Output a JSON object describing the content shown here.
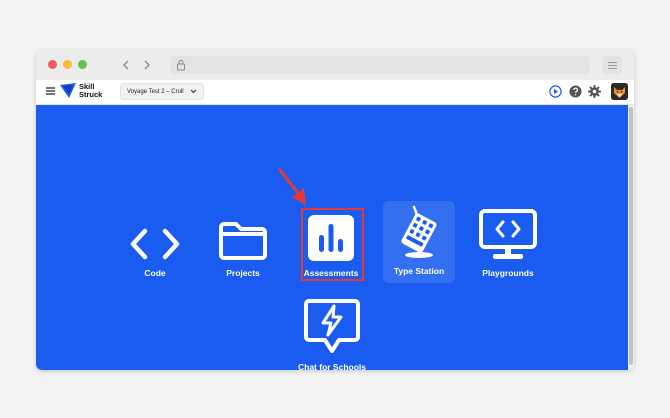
{
  "colors": {
    "content_bg": "#1a5cf0",
    "highlight_red": "#e53935",
    "brand_blue": "#1a5cf0"
  },
  "browser": {
    "icons": [
      "chevron-left-icon",
      "chevron-right-icon",
      "lock-icon",
      "menu-lines-icon"
    ]
  },
  "appbar": {
    "logo_line1": "Skill",
    "logo_line2": "Struck",
    "course_select": "Voyage Test 2 – Crull",
    "icons": [
      "hamburger-icon",
      "play-circle-icon",
      "help-circle-icon",
      "gear-icon",
      "fox-avatar"
    ]
  },
  "tiles": [
    {
      "label": "Code",
      "icon": "code-brackets-icon"
    },
    {
      "label": "Projects",
      "icon": "folder-icon"
    },
    {
      "label": "Assessments",
      "icon": "bar-chart-icon"
    },
    {
      "label": "Type Station",
      "icon": "keyboard-icon"
    },
    {
      "label": "Playgrounds",
      "icon": "monitor-code-icon"
    },
    {
      "label": "Chat for Schools",
      "icon": "chat-lightning-icon"
    }
  ]
}
